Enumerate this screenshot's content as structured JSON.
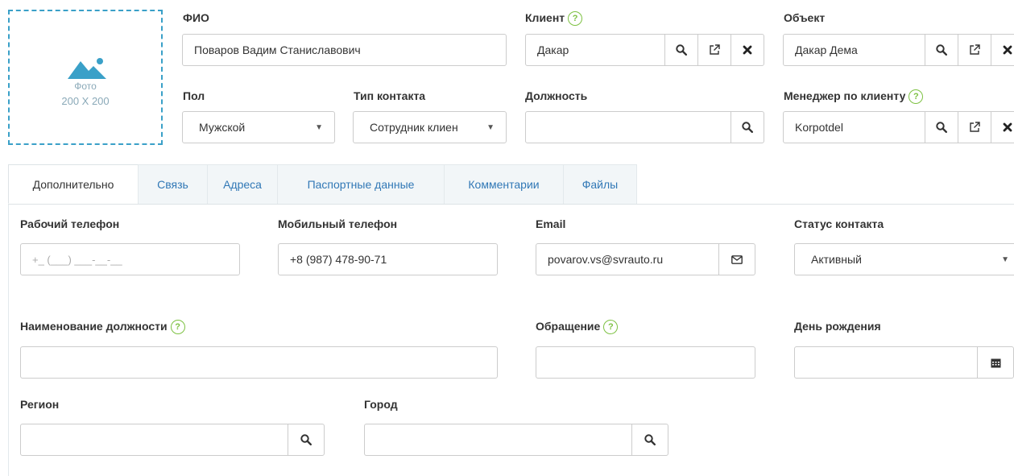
{
  "photo": {
    "label": "Фото",
    "size": "200 X 200"
  },
  "fio": {
    "label": "ФИО",
    "value": "Поваров Вадим Станиславович"
  },
  "client": {
    "label": "Клиент",
    "help": "?",
    "value": "Дакар"
  },
  "object": {
    "label": "Объект",
    "value": "Дакар Дема"
  },
  "gender": {
    "label": "Пол",
    "value": "Мужской"
  },
  "contact_type": {
    "label": "Тип контакта",
    "value": "Сотрудник клиен"
  },
  "position": {
    "label": "Должность",
    "value": ""
  },
  "manager": {
    "label": "Менеджер по клиенту",
    "help": "?",
    "value": "Korpotdel"
  },
  "tabs": [
    {
      "label": "Дополнительно"
    },
    {
      "label": "Связь"
    },
    {
      "label": "Адреса"
    },
    {
      "label": "Паспортные данные"
    },
    {
      "label": "Комментарии"
    },
    {
      "label": "Файлы"
    }
  ],
  "work_phone": {
    "label": "Рабочий телефон",
    "placeholder": "+_ (___) ___-__-__"
  },
  "mobile_phone": {
    "label": "Мобильный телефон",
    "value": "+8 (987) 478-90-71"
  },
  "email": {
    "label": "Email",
    "value": "povarov.vs@svrauto.ru"
  },
  "contact_status": {
    "label": "Статус контакта",
    "value": "Активный"
  },
  "position_name": {
    "label": "Наименование должности",
    "help": "?",
    "value": ""
  },
  "salutation": {
    "label": "Обращение",
    "help": "?",
    "value": ""
  },
  "birthday": {
    "label": "День рождения",
    "value": ""
  },
  "region": {
    "label": "Регион",
    "value": ""
  },
  "city": {
    "label": "Город",
    "value": ""
  },
  "icons": {
    "search": "search-icon",
    "external": "external-link-icon",
    "clear": "close-icon",
    "envelope": "envelope-icon",
    "calendar": "calendar-icon",
    "image": "image-placeholder-icon",
    "dropdown": "chevron-down-icon"
  },
  "colors": {
    "link": "#3178b6",
    "help": "#7dc142",
    "photo_border": "#3aa0c8"
  }
}
